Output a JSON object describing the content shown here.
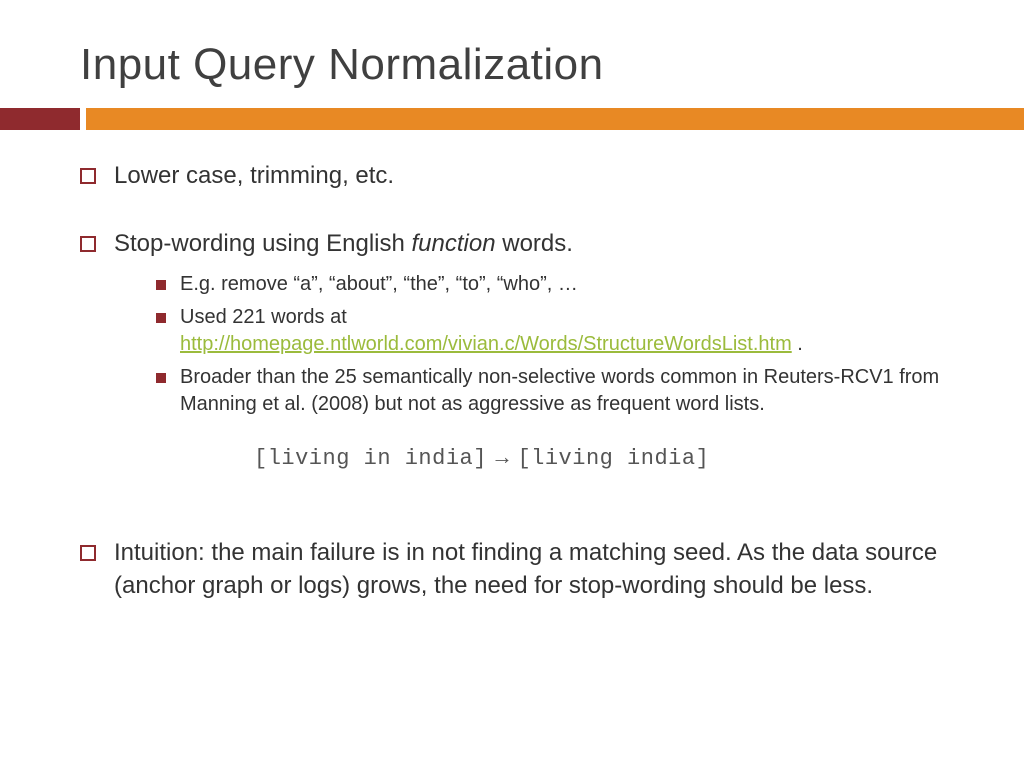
{
  "title": "Input Query Normalization",
  "bullets": {
    "b1": "Lower case, trimming, etc.",
    "b2_pre": "Stop-wording using English ",
    "b2_italic": "function",
    "b2_post": " words.",
    "s1": "E.g. remove “a”, “about”, “the”, “to”, “who”, …",
    "s2_pre": "Used 221 words at ",
    "s2_link": "http://homepage.ntlworld.com/vivian.c/Words/StructureWordsList.htm",
    "s2_post": "  .",
    "s3": "Broader than the 25 semantically non-selective words common in Reuters-RCV1 from Manning et al. (2008) but not as aggressive as frequent word lists.",
    "example_left": "[living in india]",
    "example_arrow": "→",
    "example_right": "[living india]",
    "b3": "Intuition: the main failure is in not finding a matching seed.  As the data source (anchor graph or logs) grows, the need for stop-wording should be less."
  }
}
